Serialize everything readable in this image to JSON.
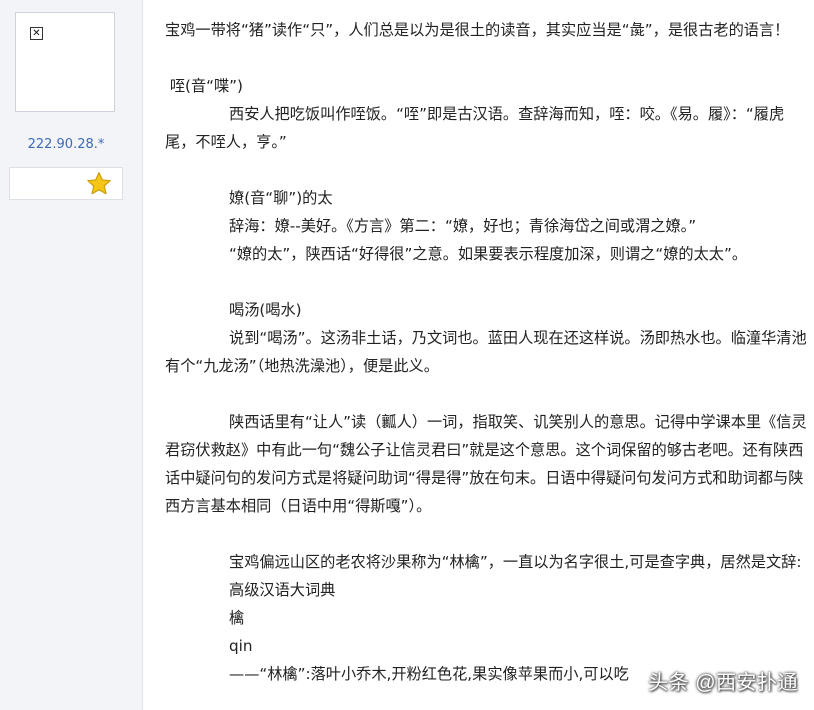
{
  "user": {
    "ip": "222.90.28.*",
    "avatar_icon": "broken-image-icon",
    "rating_icon": "star-icon",
    "star_color": "#f5c518"
  },
  "post": {
    "lines": [
      "宝鸡一带将“猪”读作“只”，人们总是以为是很土的读音，其实应当是“彘”，是很古老的语言！",
      "",
      " 咥(音“喋”)",
      "西安人把吃饭叫作咥饭。“咥”即是古汉语。查辞海而知，咥：咬。《易。履》：“履虎尾，不咥人，亨。”",
      "",
      "嫽(音“聊”)的太",
      "辞海：嫽--美好。《方言》第二：“嫽，好也；青徐海岱之间或渭之嫽。”",
      "“嫽的太”，陕西话“好得很”之意。如果要表示程度加深，则谓之“嫽的太太”。",
      "",
      "喝汤(喝水)",
      "说到“喝汤”。这汤非土话，乃文词也。蓝田人现在还这样说。汤即热水也。临潼华清池有个“九龙汤”（地热洗澡池），便是此义。",
      "",
      "陕西话里有“让人”读（瓤人）一词，指取笑、讥笑别人的意思。记得中学课本里《信灵君窃伏救赵》中有此一句“魏公子让信灵君曰”就是这个意思。这个词保留的够古老吧。还有陕西话中疑问句的发问方式是将疑问助词“得是得”放在句末。日语中得疑问句发问方式和助词都与陕西方言基本相同（日语中用“得斯嘎”）。",
      "",
      "宝鸡偏远山区的老农将沙果称为“林檎”，一直以为名字很土,可是查字典，居然是文辞:",
      "高级汉语大词典",
      "檎",
      "qin",
      "——“林檎”:落叶小乔木,开粉红色花,果实像苹果而小,可以吃"
    ]
  },
  "watermark": "头条 @西安扑通"
}
